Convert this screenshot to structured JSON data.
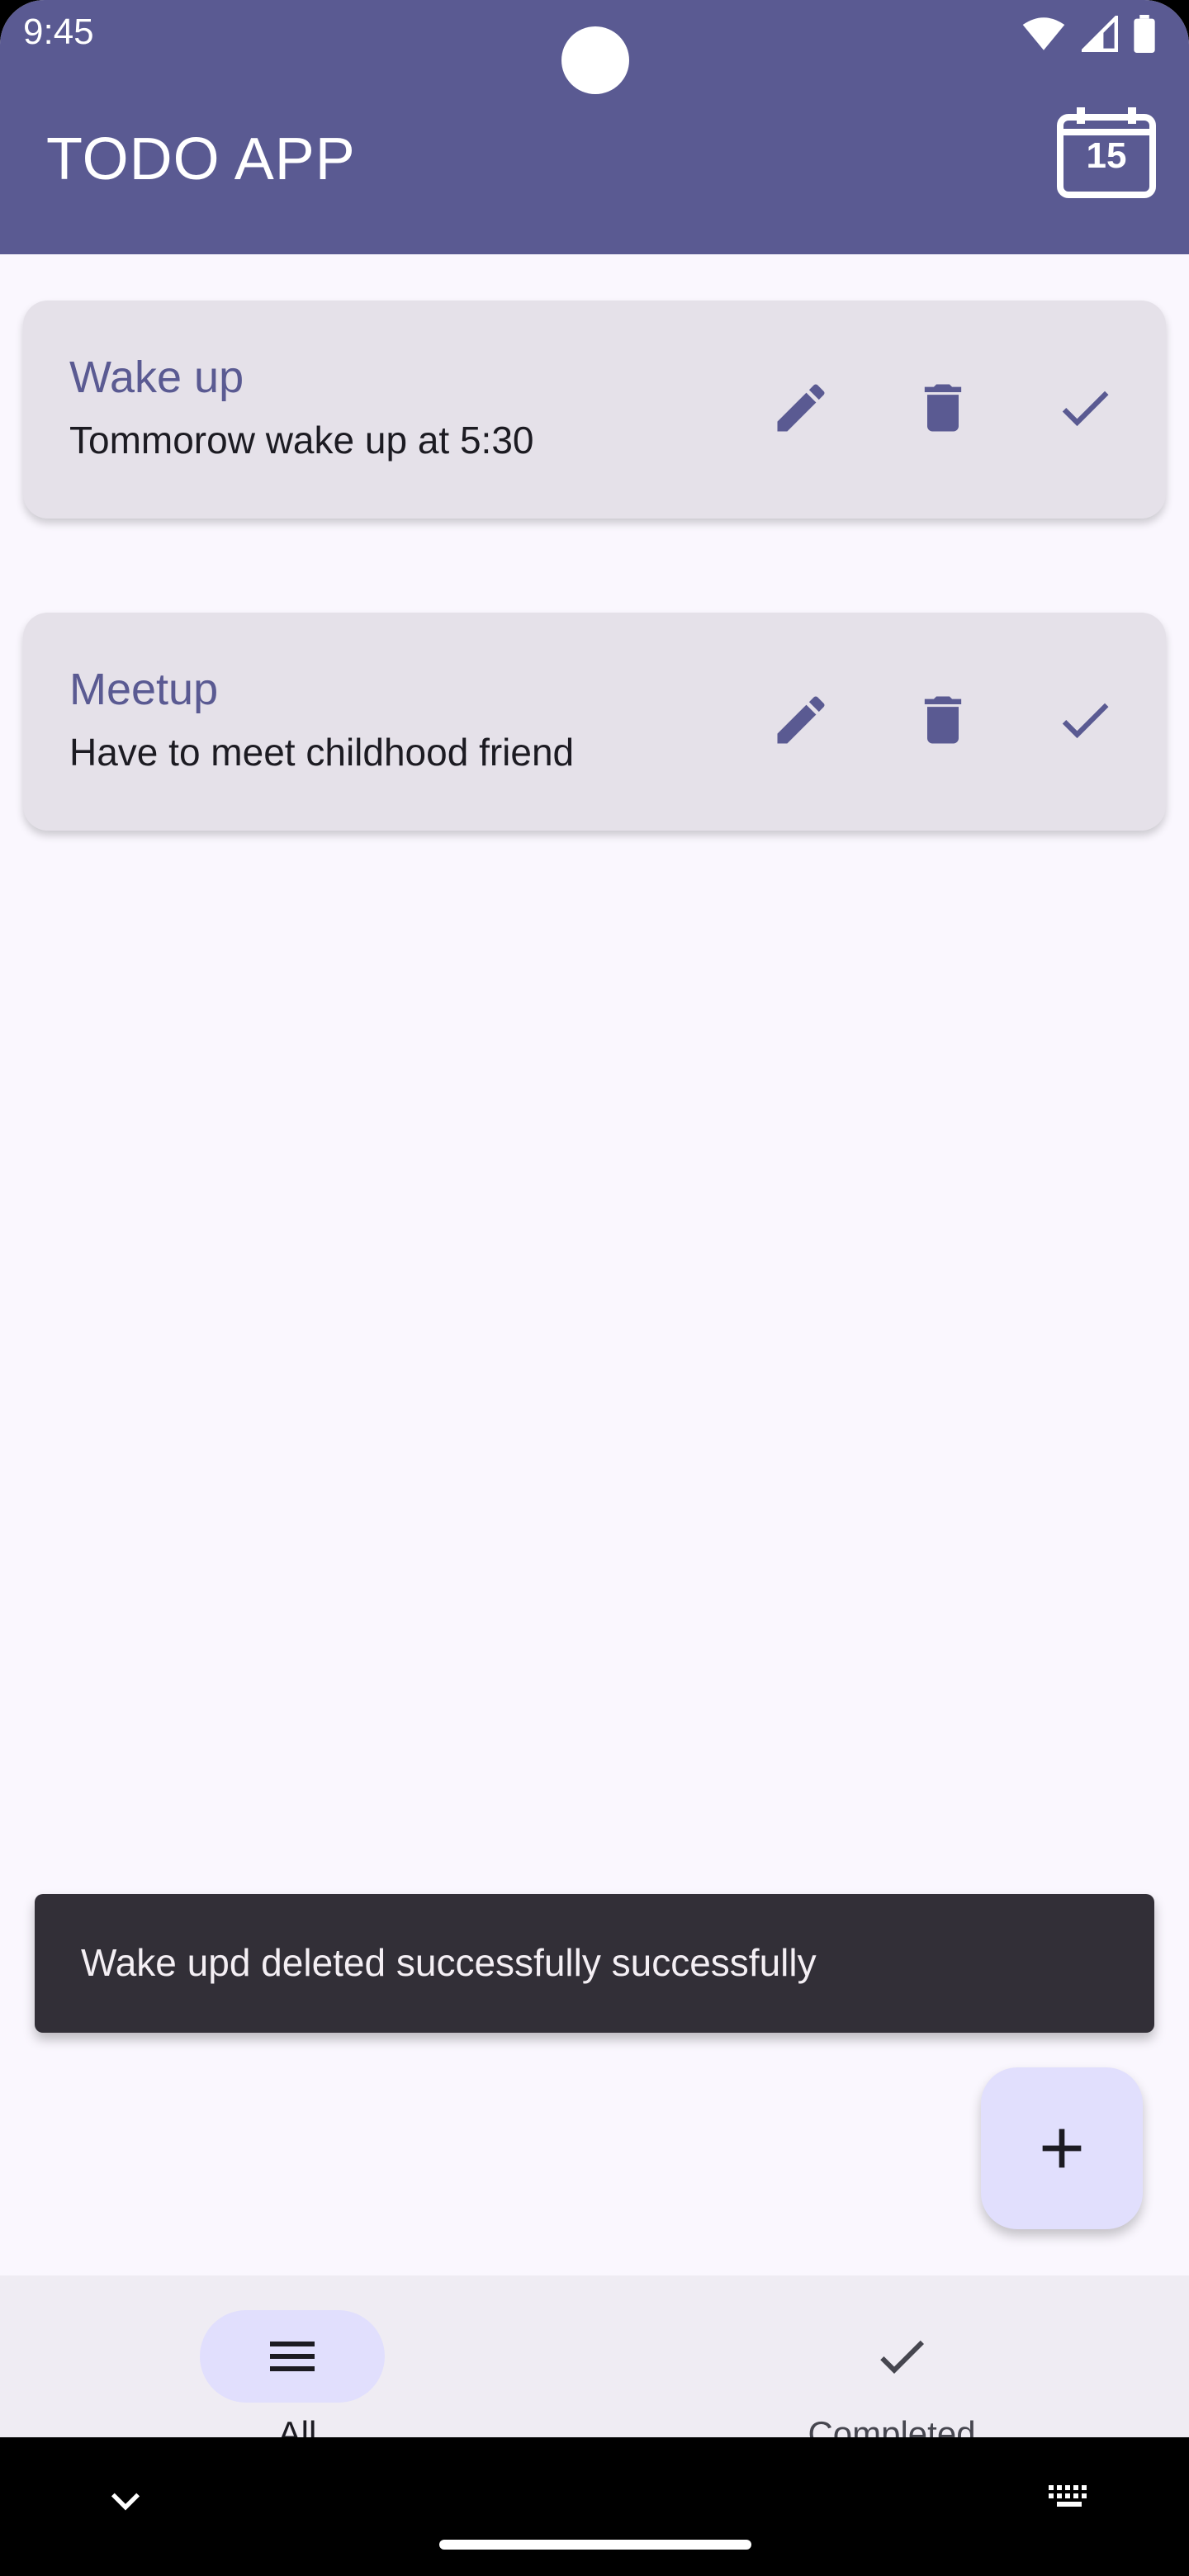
{
  "status_bar": {
    "time": "9:45"
  },
  "app_bar": {
    "title": "TODO APP",
    "calendar_day": "15"
  },
  "todos": [
    {
      "title": "Wake up",
      "description": "Tommorow wake up at 5:30"
    },
    {
      "title": "Meetup",
      "description": "Have to meet childhood friend"
    }
  ],
  "snackbar": {
    "message": "Wake upd deleted successfully  successfully"
  },
  "bottom_nav": {
    "items": [
      {
        "label": "All",
        "icon": "menu-icon",
        "selected": true
      },
      {
        "label": "Completed",
        "icon": "check-icon",
        "selected": false
      }
    ]
  },
  "colors": {
    "primary": "#5A5A92",
    "surface": "#FAF7FE",
    "card": "#E5E1E9",
    "snackbar": "#322F37",
    "fab": "#E1DFFD"
  }
}
